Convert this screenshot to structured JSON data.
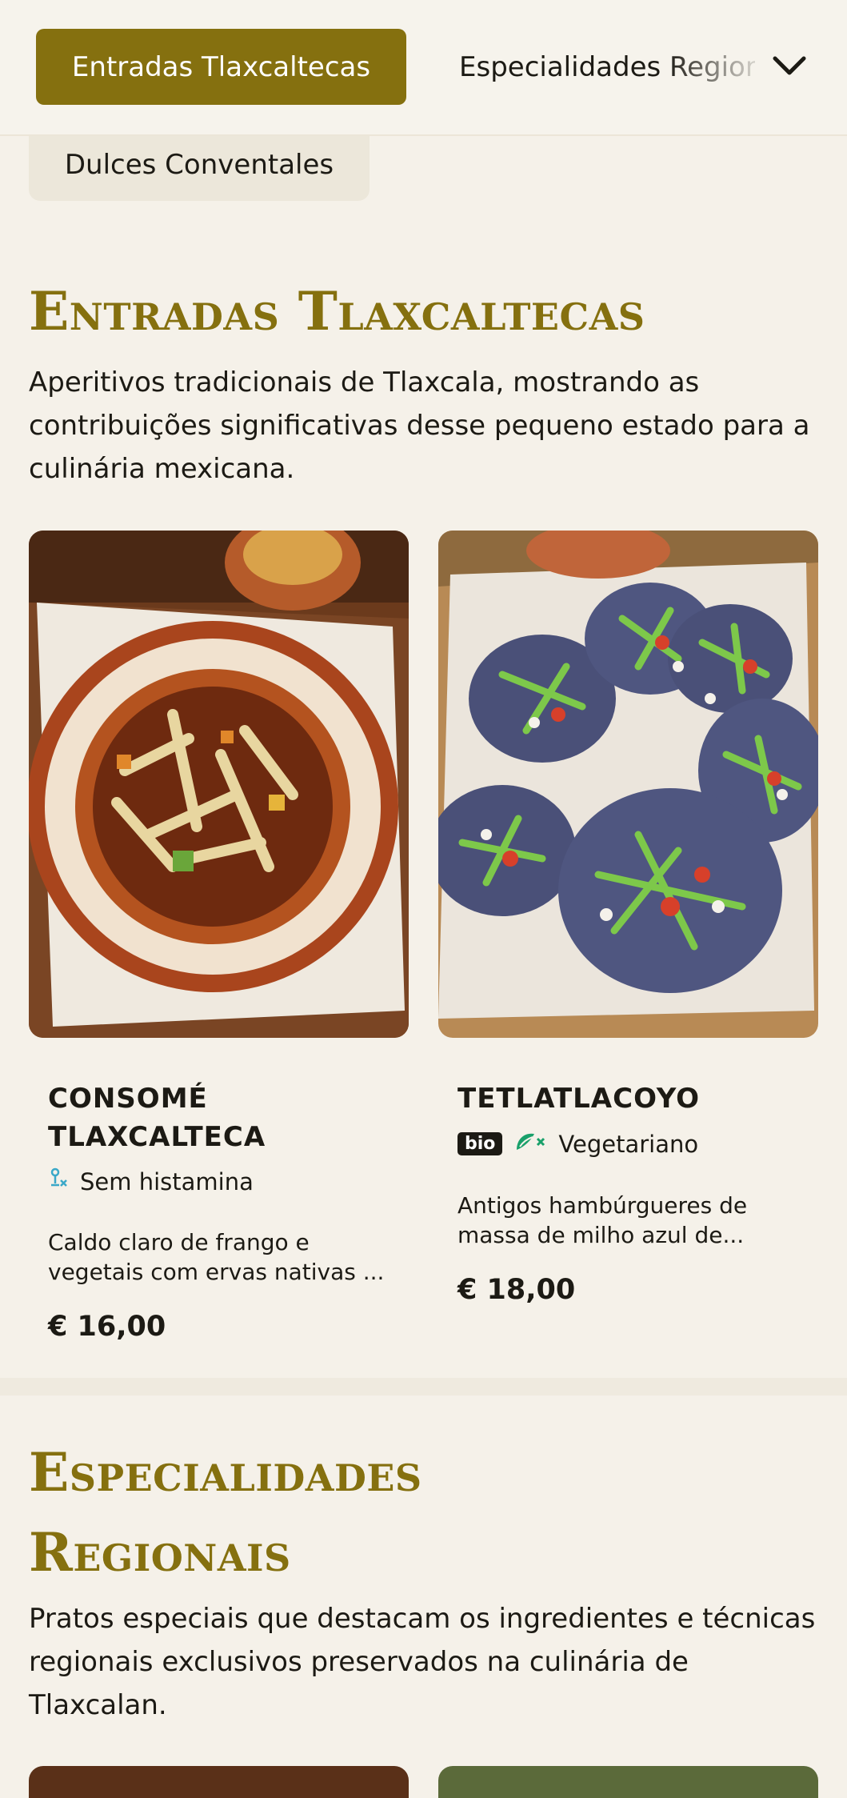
{
  "nav": {
    "active_tab": "Entradas Tlaxcaltecas",
    "next_tab": "Especialidades Regionais",
    "wrapped_tab": "Dulces Conventales",
    "expand_icon": "chevron-down-icon"
  },
  "sections": [
    {
      "title": "Entradas Tlaxcaltecas",
      "description": "Aperitivos tradicionais de Tlaxcala, mostrando as contribuições significativas desse pequeno estado para a culinária mexicana.",
      "items": [
        {
          "name": "CONSOMÉ TLAXCALTECA",
          "tag": "Sem histamina",
          "tag_icon": "histamine-free-icon",
          "description": "Caldo claro de frango e vegetais com ervas nativas ...",
          "price": "€ 16,00"
        },
        {
          "name": "TETLATLACOYO",
          "badge": "bio",
          "tag": "Vegetariano",
          "tag_icon": "vegetarian-icon",
          "description": "Antigos hambúrgueres de massa de milho azul de...",
          "price": "€ 18,00"
        }
      ]
    },
    {
      "title": "Especialidades Regionais",
      "description": "Pratos especiais que destacam os ingredientes e técnicas regionais exclusivos preservados na culinária de Tlaxcalan."
    }
  ],
  "colors": {
    "accent": "#85700f",
    "background": "#f5f1e9",
    "tag_histamine": "#3aa8c8",
    "tag_vegetarian": "#19a06a"
  }
}
